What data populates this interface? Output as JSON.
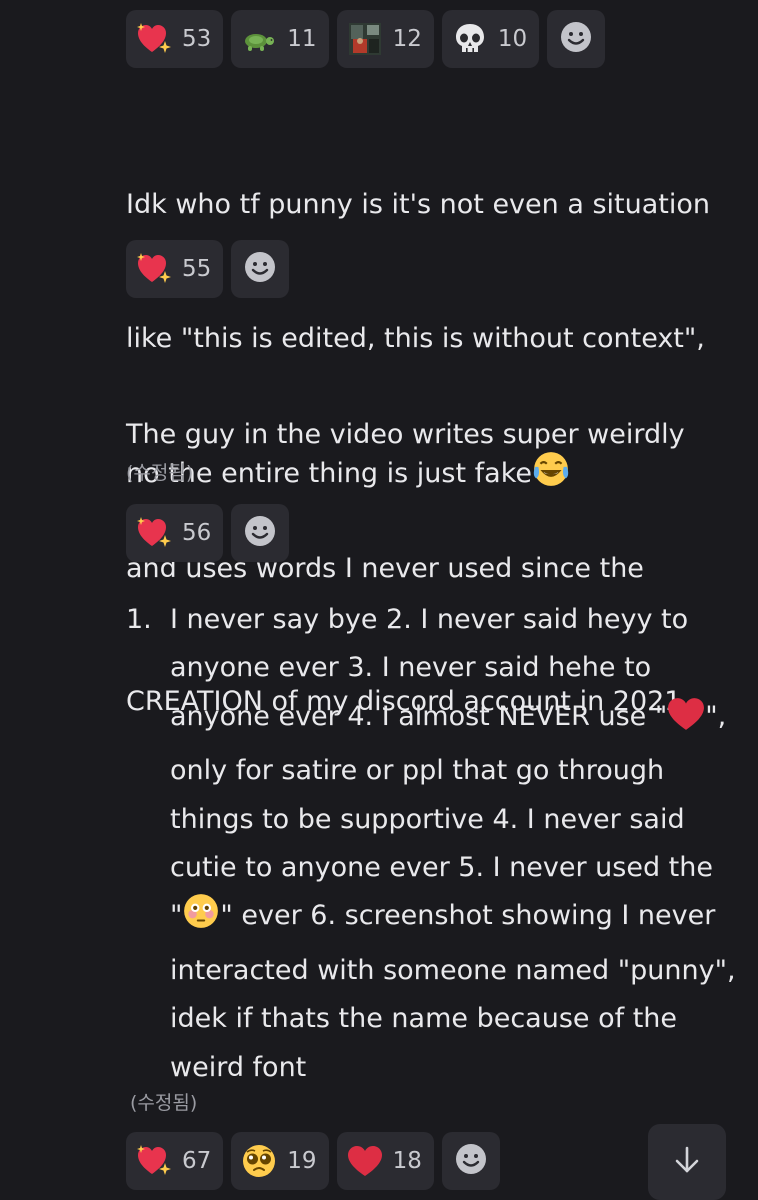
{
  "reactions_1": [
    {
      "icon": "sparkling-heart-icon",
      "count": "53"
    },
    {
      "icon": "turtle-icon",
      "count": "11"
    },
    {
      "icon": "custom-image-emoji-icon",
      "count": "12"
    },
    {
      "icon": "skull-icon",
      "count": "10"
    }
  ],
  "message_1": {
    "lines": [
      "Idk who tf punny is it's not even a situation",
      "like \"this is edited, this is without context\",",
      "no the entire thing is just fake"
    ],
    "trailing_emoji": "face-with-tears-of-joy-icon"
  },
  "reactions_2": [
    {
      "icon": "sparkling-heart-icon",
      "count": "55"
    }
  ],
  "message_2": {
    "lines": [
      "The guy in the video writes super weirdly",
      "and uses words I never used since the",
      "CREATION of my discord account in 2021"
    ],
    "edited": "(수정됨)"
  },
  "reactions_3": [
    {
      "icon": "sparkling-heart-icon",
      "count": "56"
    }
  ],
  "message_3": {
    "number": "1.",
    "lines": [
      "I never say bye 2. I never said heyy to",
      "anyone ever 3. I never said hehe to",
      "anyone ever 4. I almost NEVER use \"",
      "\",",
      "only for satire or ppl that go through",
      "things to be supportive 4. I never said",
      "cutie to anyone ever 5. I never used the",
      "\"",
      "\" ever 6. screenshot showing I never",
      "interacted with someone named \"punny\",",
      "idek if thats the name because of the",
      "weird font"
    ],
    "edited": "(수정됨)"
  },
  "reactions_4": [
    {
      "icon": "sparkling-heart-icon",
      "count": "67"
    },
    {
      "icon": "pleading-face-icon",
      "count": "19"
    },
    {
      "icon": "red-heart-icon",
      "count": "18"
    }
  ],
  "colors": {
    "background": "#1a1a1e",
    "chip": "#2b2b31",
    "text": "#e9e9ec",
    "muted": "#9a9ba2"
  }
}
